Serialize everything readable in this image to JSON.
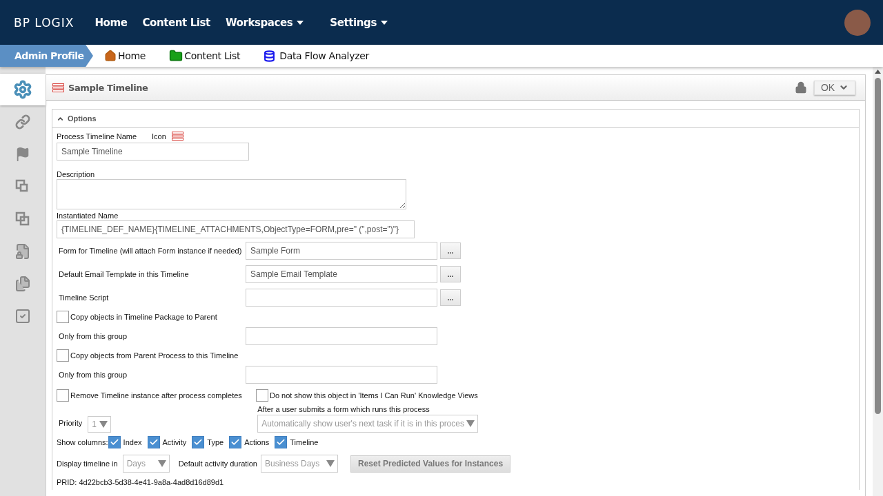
{
  "header": {
    "logo": "BP LOGIX",
    "nav": [
      {
        "label": "Home",
        "dropdown": false
      },
      {
        "label": "Content List",
        "dropdown": false
      },
      {
        "label": "Workspaces",
        "dropdown": true
      },
      {
        "label": "Settings",
        "dropdown": true
      }
    ]
  },
  "breadcrumb": {
    "profile": "Admin Profile",
    "links": [
      {
        "label": "Home"
      },
      {
        "label": "Content List"
      },
      {
        "label": "Data Flow Analyzer"
      }
    ]
  },
  "sidebar": [
    {
      "selected": true
    },
    {
      "selected": false
    },
    {
      "selected": false
    },
    {
      "selected": false
    },
    {
      "selected": false
    },
    {
      "selected": false
    },
    {
      "selected": false
    },
    {
      "selected": false
    }
  ],
  "panel": {
    "title": "Sample Timeline",
    "locked": true,
    "ok_button": "OK"
  },
  "options": {
    "title": "Options",
    "expanded": true,
    "name_label": "Process Timeline Name",
    "icon_label": "Icon",
    "name_value": "Sample Timeline",
    "description_label": "Description",
    "instantiated_label": "Instantiated Name",
    "instantiated_value": "{TIMELINE_DEF_NAME}{TIMELINE_ATTACHMENTS,ObjectType=FORM,pre=\" (\",post=\")\"}",
    "rows": [
      {
        "kind": "picker",
        "label": "Form for Timeline (will attach Form instance if needed)",
        "value": "Sample Form",
        "button": "..."
      },
      {
        "kind": "picker",
        "label": "Default Email Template in this Timeline",
        "value": "Sample Email Template",
        "button": "..."
      },
      {
        "kind": "picker",
        "label": "Timeline Script",
        "button": "..."
      },
      {
        "kind": "checkbox",
        "label": "Copy objects in Timeline Package to Parent",
        "checked": false
      },
      {
        "kind": "text",
        "label": "Only from this group"
      },
      {
        "kind": "checkbox",
        "label": "Copy objects from Parent Process to this Timeline",
        "checked": false
      },
      {
        "kind": "text",
        "label": "Only from this group"
      }
    ],
    "remove_checkbox": {
      "label": "Remove Timeline instance after process completes",
      "checked": false
    },
    "hide_checkbox": {
      "label": "Do not show this object in 'Items I Can Run' Knowledge Views",
      "checked": false
    },
    "priority": {
      "label": "Priority",
      "value": "1",
      "disabled": true
    },
    "after_submit": {
      "label": "After a user submits a form which runs this process",
      "value": "Automatically show user's next task if it is in this proces",
      "disabled": true
    },
    "show_columns": {
      "label": "Show columns:",
      "columns": [
        {
          "label": "Index",
          "checked": true
        },
        {
          "label": "Activity",
          "checked": true
        },
        {
          "label": "Type",
          "checked": true
        },
        {
          "label": "Actions",
          "checked": true
        },
        {
          "label": "Timeline",
          "checked": true
        }
      ]
    },
    "display": {
      "label": "Display timeline in",
      "value": "Days",
      "disabled": true
    },
    "duration": {
      "label": "Default activity duration",
      "value": "Business Days",
      "disabled": true
    },
    "reset_button": {
      "label": "Reset Predicted Values for Instances",
      "disabled": true
    },
    "prid": "PRID: 4d22bcb3-5d38-4e41-9a8a-4ad8d16d89d1"
  }
}
